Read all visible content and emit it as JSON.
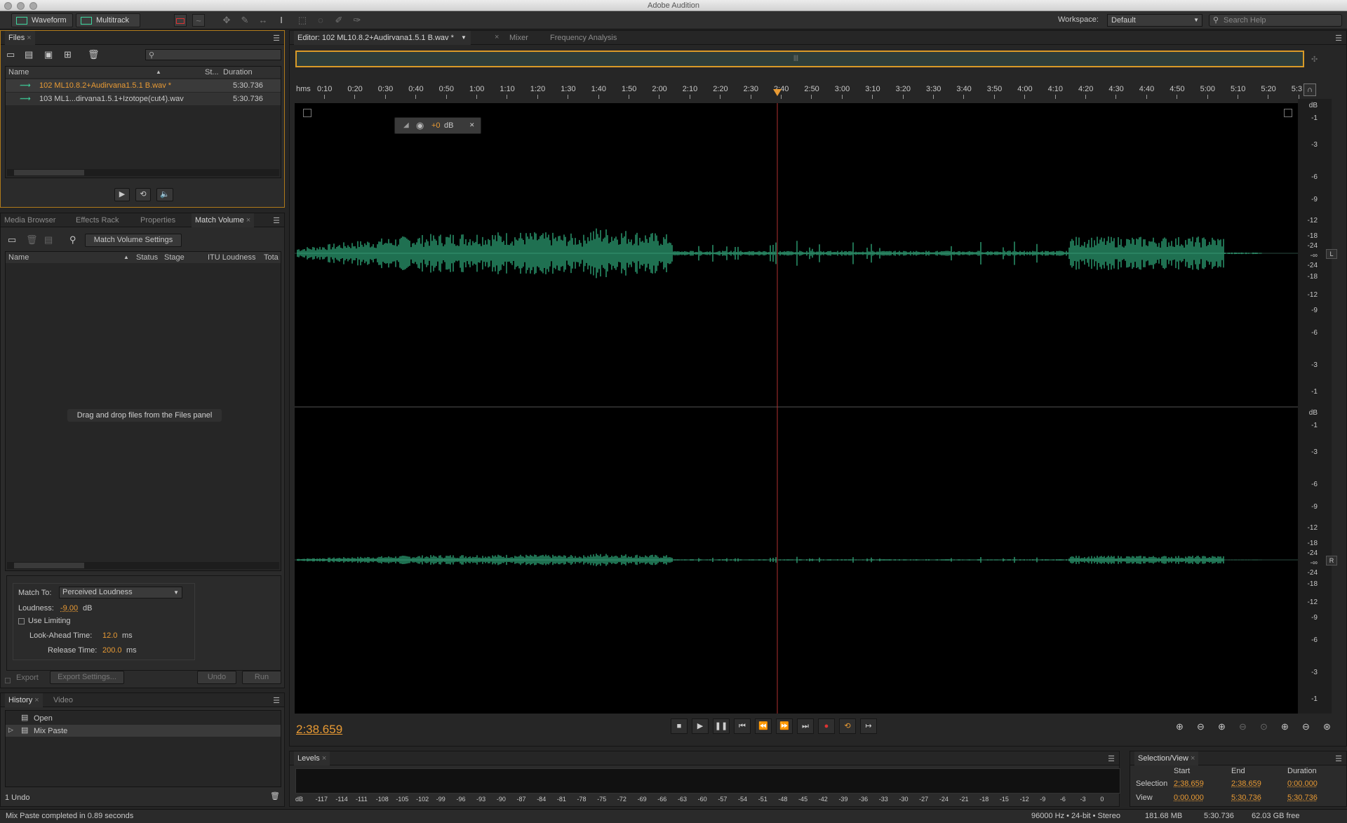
{
  "window": {
    "title": "Adobe Audition"
  },
  "toolbar": {
    "waveform_label": "Waveform",
    "multitrack_label": "Multitrack",
    "workspace_label": "Workspace:",
    "workspace_value": "Default",
    "search_placeholder": "Search Help"
  },
  "files_panel": {
    "tab": "Files",
    "col_name": "Name",
    "col_status": "St...",
    "col_duration": "Duration",
    "rows": [
      {
        "name": "102 ML10.8.2+Audirvana1.5.1 B.wav *",
        "duration": "5:30.736"
      },
      {
        "name": "103 ML1...dirvana1.5.1+Izotope(cut4).wav",
        "duration": "5:30.736"
      }
    ]
  },
  "mid_panel": {
    "tabs": [
      "Media Browser",
      "Effects Rack",
      "Properties",
      "Match Volume"
    ],
    "settings_button": "Match Volume Settings",
    "columns": [
      "Name",
      "Status",
      "Stage",
      "ITU Loudness",
      "Tota"
    ],
    "empty_hint": "Drag and drop files from the Files panel",
    "match_to_label": "Match To:",
    "match_to_value": "Perceived Loudness",
    "loudness_label": "Loudness:",
    "loudness_value": "-9.00",
    "loudness_unit": "dB",
    "use_limiting_label": "Use Limiting",
    "lookahead_label": "Look-Ahead Time:",
    "lookahead_value": "12.0",
    "lookahead_unit": "ms",
    "release_label": "Release Time:",
    "release_value": "200.0",
    "release_unit": "ms",
    "export_label": "Export",
    "export_settings_label": "Export Settings...",
    "undo_label": "Undo",
    "run_label": "Run"
  },
  "history_panel": {
    "tabs": [
      "History",
      "Video"
    ],
    "items": [
      "Open",
      "Mix Paste"
    ],
    "undo_count": "1 Undo"
  },
  "editor": {
    "tab": "Editor: 102 ML10.8.2+Audirvana1.5.1 B.wav *",
    "tabs_other": [
      "Mixer",
      "Frequency Analysis"
    ],
    "ruler_unit": "hms",
    "ruler_ticks": [
      "0:10",
      "0:20",
      "0:30",
      "0:40",
      "0:50",
      "1:00",
      "1:10",
      "1:20",
      "1:30",
      "1:40",
      "1:50",
      "2:00",
      "2:10",
      "2:20",
      "2:30",
      "2:40",
      "2:50",
      "3:00",
      "3:10",
      "3:20",
      "3:30",
      "3:40",
      "3:50",
      "4:00",
      "4:10",
      "4:20",
      "4:30",
      "4:40",
      "4:50",
      "5:00",
      "5:10",
      "5:20",
      "5:3"
    ],
    "hud_gain": "+0",
    "hud_unit": "dB",
    "current_time": "2:38.659",
    "db_labels_top": [
      "dB",
      "-1",
      "-3",
      "-6",
      "-9",
      "-12",
      "-18",
      "-24",
      "-∞",
      "-24",
      "-18",
      "-12",
      "-9",
      "-6",
      "-3",
      "-1"
    ],
    "db_labels_bottom": [
      "dB",
      "-1",
      "-3",
      "-6",
      "-9",
      "-12",
      "-18",
      "-24",
      "-∞",
      "-24",
      "-18",
      "-12",
      "-9",
      "-6",
      "-3",
      "-1"
    ],
    "channel_left": "L",
    "channel_right": "R",
    "wave_color": "#3ee0a2"
  },
  "levels_panel": {
    "tab": "Levels",
    "scale": [
      "dB",
      "-117",
      "-114",
      "-111",
      "-108",
      "-105",
      "-102",
      "-99",
      "-96",
      "-93",
      "-90",
      "-87",
      "-84",
      "-81",
      "-78",
      "-75",
      "-72",
      "-69",
      "-66",
      "-63",
      "-60",
      "-57",
      "-54",
      "-51",
      "-48",
      "-45",
      "-42",
      "-39",
      "-36",
      "-33",
      "-30",
      "-27",
      "-24",
      "-21",
      "-18",
      "-15",
      "-12",
      "-9",
      "-6",
      "-3",
      "0"
    ]
  },
  "selection_view": {
    "tab": "Selection/View",
    "col_start": "Start",
    "col_end": "End",
    "col_duration": "Duration",
    "selection_label": "Selection",
    "selection_start": "2:38.659",
    "selection_end": "2:38.659",
    "selection_duration": "0:00.000",
    "view_label": "View",
    "view_start": "0:00.000",
    "view_end": "5:30.736",
    "view_duration": "5:30.736"
  },
  "status_bar": {
    "message": "Mix Paste completed in 0.89 seconds",
    "format": "96000 Hz • 24-bit • Stereo",
    "size": "181.68 MB",
    "duration": "5:30.736",
    "free": "62.03 GB free"
  }
}
